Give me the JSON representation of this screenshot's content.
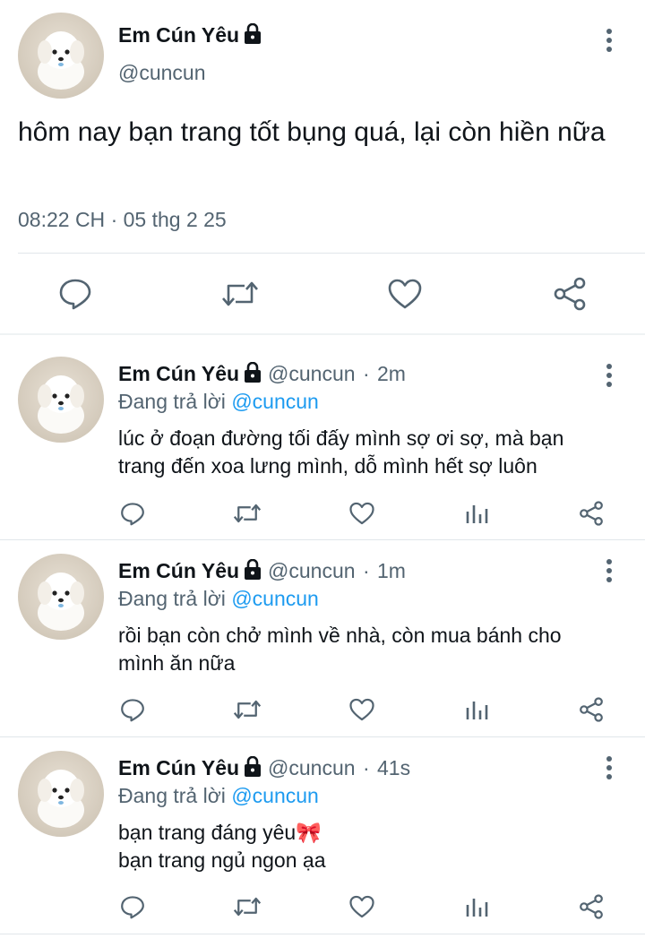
{
  "main_tweet": {
    "display_name": "Em Cún Yêu",
    "handle": "@cuncun",
    "text": "hôm nay bạn trang tốt bụng quá, lại còn hiền nữa",
    "time": "08:22 CH",
    "separator": "·",
    "date": "05 thg 2 25",
    "actions": [
      "reply-icon",
      "retweet-icon",
      "like-icon",
      "share-icon"
    ]
  },
  "replies": [
    {
      "display_name": "Em Cún Yêu",
      "handle": "@cuncun",
      "separator": "·",
      "time_ago": "2m",
      "replying_prefix": "Đang trả lời",
      "replying_to": "@cuncun",
      "lines": [
        "lúc ở đoạn đường tối đấy mình sợ ơi sợ, mà bạn",
        "trang đến xoa lưng mình, dỗ mình hết sợ luôn"
      ]
    },
    {
      "display_name": "Em Cún Yêu",
      "handle": "@cuncun",
      "separator": "·",
      "time_ago": "1m",
      "replying_prefix": "Đang trả lời",
      "replying_to": "@cuncun",
      "lines": [
        "rồi bạn còn chở mình về nhà, còn mua bánh cho",
        "mình ăn nữa"
      ]
    },
    {
      "display_name": "Em Cún Yêu",
      "handle": "@cuncun",
      "separator": "·",
      "time_ago": "41s",
      "replying_prefix": "Đang trả lời",
      "replying_to": "@cuncun",
      "lines": [
        "bạn trang đáng yêu",
        "bạn trang ngủ ngon ạa"
      ],
      "emoji": "🎀"
    }
  ],
  "colors": {
    "text": "#0f1419",
    "muted": "#536471",
    "link": "#1d9bf0",
    "divider": "#e1e6ea"
  }
}
